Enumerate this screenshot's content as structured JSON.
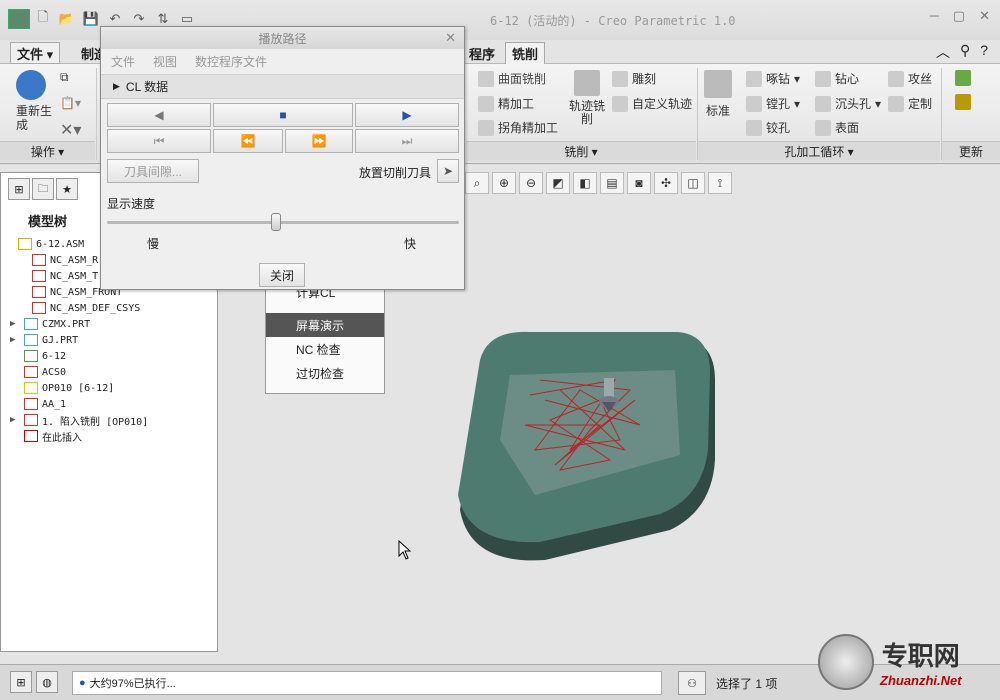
{
  "window": {
    "title": "6-12 (活动的) - Creo Parametric 1.0"
  },
  "ribbon_tabs": [
    "文件 ▾",
    "制造",
    "程序",
    "铣削"
  ],
  "ribbon": {
    "regenerate": "重新生成",
    "ops_group": "操作 ▾",
    "milling_items": [
      "曲面铣削",
      "精加工",
      "拐角精加工",
      "轨迹铣削",
      "雕刻",
      "自定义轨迹"
    ],
    "milling_group": "铣削 ▾",
    "hole_items": [
      "标准",
      "啄钻",
      "镗孔",
      "铰孔",
      "钻心",
      "沉头孔",
      "表面",
      "攻丝",
      "定制"
    ],
    "hole_group": "孔加工循环 ▾",
    "update_group": "更新"
  },
  "model_tree": {
    "title": "模型树",
    "items": [
      {
        "text": "6-12.ASM",
        "expander": ""
      },
      {
        "text": "NC_ASM_R",
        "expander": ""
      },
      {
        "text": "NC_ASM_T",
        "expander": ""
      },
      {
        "text": "NC_ASM_FRONT",
        "expander": ""
      },
      {
        "text": "NC_ASM_DEF_CSYS",
        "expander": ""
      },
      {
        "text": "CZMX.PRT",
        "expander": "▶"
      },
      {
        "text": "GJ.PRT",
        "expander": "▶"
      },
      {
        "text": "6-12",
        "expander": ""
      },
      {
        "text": "ACS0",
        "expander": ""
      },
      {
        "text": "OP010 [6-12]",
        "expander": ""
      },
      {
        "text": "AA_1",
        "expander": ""
      },
      {
        "text": "1. 陷入铣削 [OP010]",
        "expander": "▶"
      },
      {
        "text": "在此插入",
        "expander": ""
      }
    ]
  },
  "context_menu": {
    "partial": "计算CL",
    "items": [
      "屏幕演示",
      "NC 检查",
      "过切检查"
    ],
    "selected": 0
  },
  "dialog": {
    "title": "播放路径",
    "menu": [
      "文件",
      "视图",
      "数控程序文件"
    ],
    "cl_data": "CL 数据",
    "tool_clearance": "刀具间隙...",
    "place_tool": "放置切削刀具",
    "speed_label": "显示速度",
    "slow": "慢",
    "fast": "快",
    "speed_value": 0.48,
    "close": "关闭"
  },
  "status": {
    "message": "大约97%已执行...",
    "selection": "选择了 1 项"
  },
  "watermark": {
    "brand": "专职网",
    "url": "Zhuanzhi.Net"
  },
  "colors": {
    "part": "#4e7b70",
    "toolpath": "#cc1111",
    "highlight": "#555555"
  }
}
